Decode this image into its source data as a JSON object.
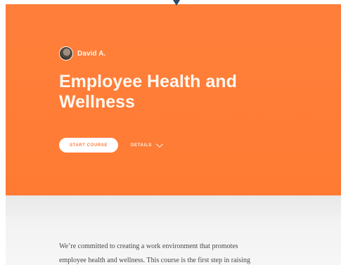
{
  "author": {
    "name": "David A."
  },
  "course": {
    "title_line_1": "Employee Health and",
    "title_line_2": "Wellness"
  },
  "actions": {
    "start_label": "START COURSE",
    "details_label": "DETAILS"
  },
  "description": {
    "line_1": "We’re committed to creating a work environment that promotes",
    "line_2": "employee health and wellness. This course is the first step in raising"
  },
  "colors": {
    "hero": "#ff7f3a",
    "button_text": "#ff7c38",
    "background": "#f3f3f3"
  }
}
